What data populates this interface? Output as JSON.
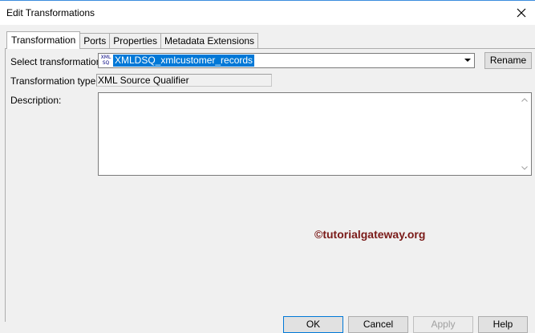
{
  "window": {
    "title": "Edit Transformations"
  },
  "tabs": [
    {
      "label": "Transformation",
      "active": true
    },
    {
      "label": "Ports",
      "active": false
    },
    {
      "label": "Properties",
      "active": false
    },
    {
      "label": "Metadata Extensions",
      "active": false
    }
  ],
  "form": {
    "select_label": "Select transformation:",
    "select_icon_text": "XML SQ",
    "select_value": "XMLDSQ_xmlcustomer_records",
    "rename_label": "Rename",
    "type_label": "Transformation type:",
    "type_value": "XML Source Qualifier",
    "description_label": "Description:",
    "description_value": ""
  },
  "watermark": "©tutorialgateway.org",
  "footer": {
    "ok": "OK",
    "cancel": "Cancel",
    "apply": "Apply",
    "help": "Help"
  },
  "colors": {
    "selection": "#0078d7",
    "watermark": "#7a1a18",
    "title_border": "#3c8dde"
  }
}
